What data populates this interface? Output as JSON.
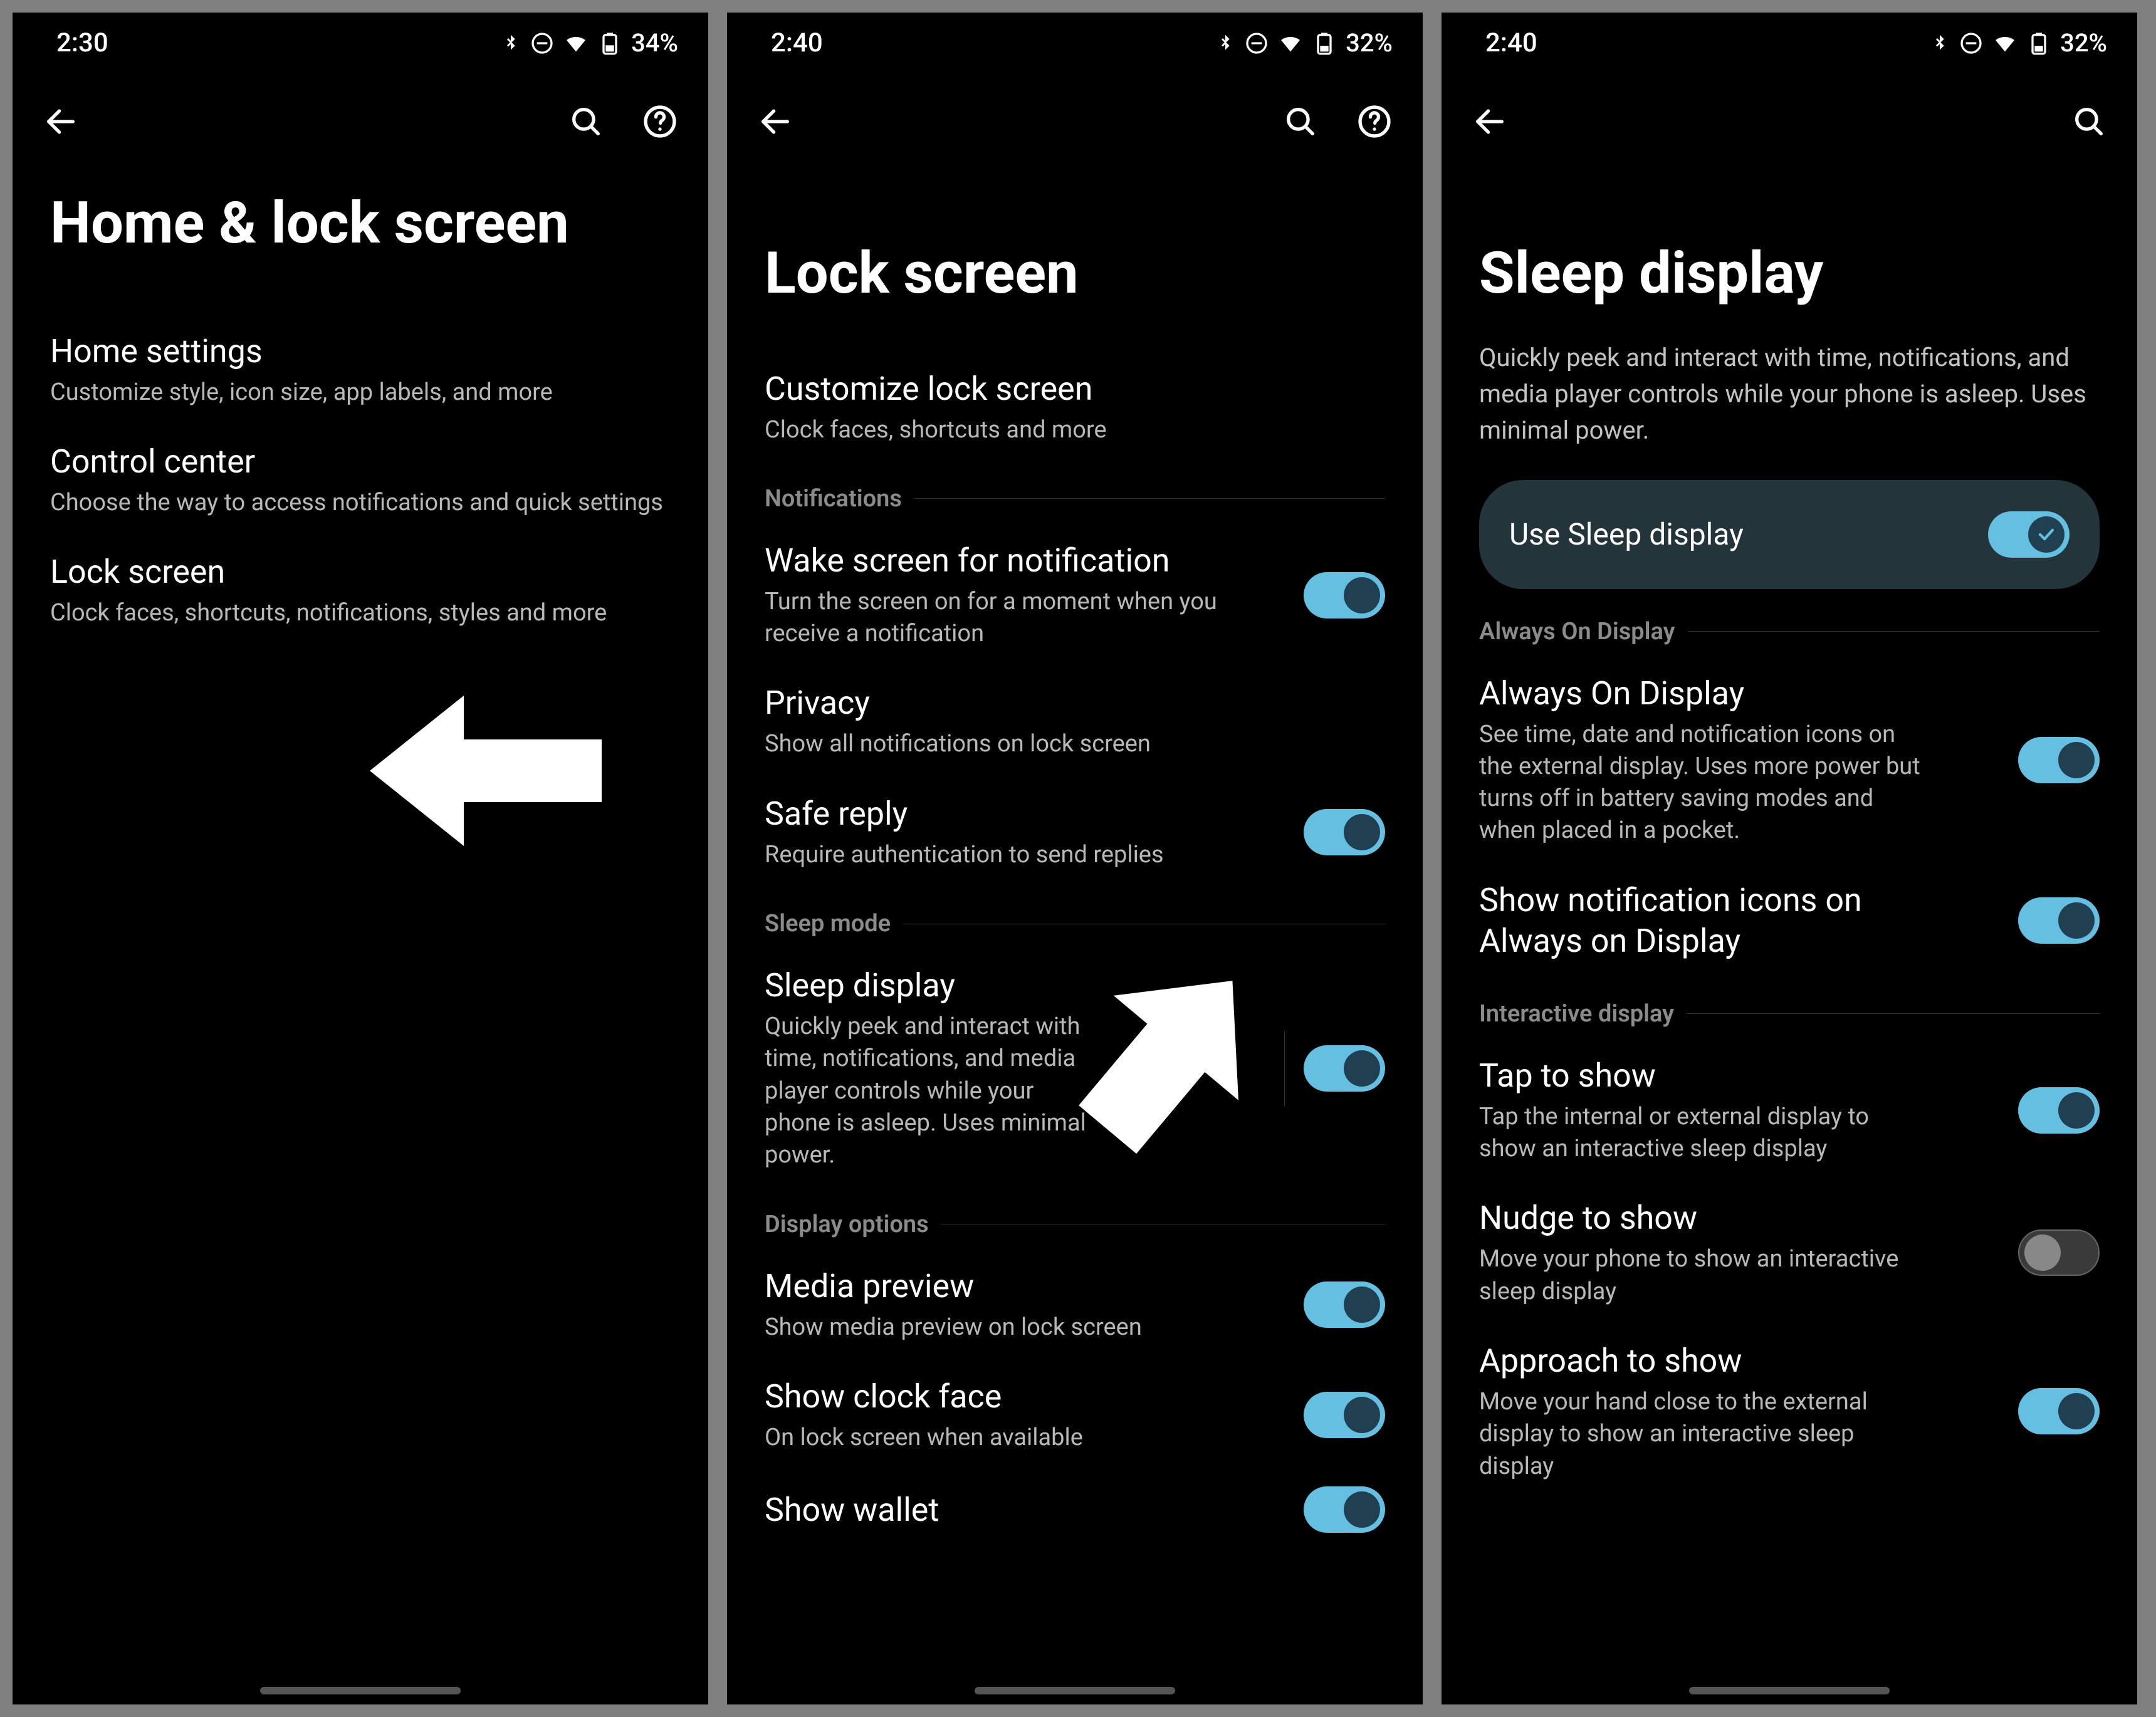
{
  "accent": "#65bfe0",
  "screens": [
    {
      "status": {
        "time": "2:30",
        "battery": "34%"
      },
      "title": "Home & lock screen",
      "has_help": true,
      "items": [
        {
          "title": "Home settings",
          "sub": "Customize style, icon size, app labels, and more"
        },
        {
          "title": "Control center",
          "sub": "Choose the way to access notifications and quick settings"
        },
        {
          "title": "Lock screen",
          "sub": "Clock faces, shortcuts, notifications, styles and more"
        }
      ]
    },
    {
      "status": {
        "time": "2:40",
        "battery": "32%"
      },
      "title": "Lock screen",
      "has_help": true,
      "top_item": {
        "title": "Customize lock screen",
        "sub": "Clock faces, shortcuts and more"
      },
      "sections": [
        {
          "head": "Notifications",
          "rows": [
            {
              "title": "Wake screen for notification",
              "sub": "Turn the screen on for a moment when you receive a notification",
              "toggle": "on"
            },
            {
              "title": "Privacy",
              "sub": "Show all notifications on lock screen"
            },
            {
              "title": "Safe reply",
              "sub": "Require authentication to send replies",
              "toggle": "on"
            }
          ]
        },
        {
          "head": "Sleep mode",
          "rows": [
            {
              "title": "Sleep display",
              "sub": "Quickly peek and interact with time, notifications, and media player controls while your phone is asleep. Uses minimal power.",
              "toggle": "on",
              "vdiv": true
            }
          ]
        },
        {
          "head": "Display options",
          "rows": [
            {
              "title": "Media preview",
              "sub": "Show media preview on lock screen",
              "toggle": "on"
            },
            {
              "title": "Show clock face",
              "sub": "On lock screen when available",
              "toggle": "on"
            },
            {
              "title": "Show wallet",
              "toggle": "on"
            }
          ]
        }
      ]
    },
    {
      "status": {
        "time": "2:40",
        "battery": "32%"
      },
      "title": "Sleep display",
      "has_help": false,
      "intro": "Quickly peek and interact with time, notifications, and media player controls while your phone is asleep. Uses minimal power.",
      "card": {
        "label": "Use Sleep display",
        "toggle": "check"
      },
      "sections": [
        {
          "head": "Always On Display",
          "rows": [
            {
              "title": "Always On Display",
              "sub": "See time, date and notification icons on the external display. Uses more power but turns off in battery saving modes and when placed in a pocket.",
              "toggle": "on"
            },
            {
              "title": "Show notification icons on Always on Display",
              "toggle": "on"
            }
          ]
        },
        {
          "head": "Interactive display",
          "rows": [
            {
              "title": "Tap to show",
              "sub": "Tap the internal or external display to show an interactive sleep display",
              "toggle": "on"
            },
            {
              "title": "Nudge to show",
              "sub": "Move your phone to show an interactive sleep display",
              "toggle": "off"
            },
            {
              "title": "Approach to show",
              "sub": "Move your hand close to the external display to show an interactive sleep display",
              "toggle": "on"
            }
          ]
        }
      ]
    }
  ]
}
